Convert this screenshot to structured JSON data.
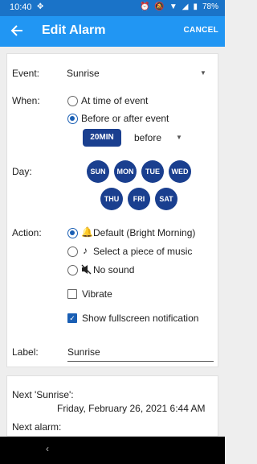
{
  "status_bar": {
    "time": "10:40",
    "battery": "78%",
    "icons": [
      "android-debug-icon",
      "alarm-icon",
      "mute-icon",
      "wifi-icon",
      "signal-icon",
      "battery-icon"
    ]
  },
  "app_bar": {
    "title": "Edit Alarm",
    "cancel_label": "CANCEL",
    "back_icon": "arrow-left-icon",
    "background_color": "#2196f3"
  },
  "form": {
    "event": {
      "label": "Event:",
      "value": "Sunrise"
    },
    "when": {
      "label": "When:",
      "options": [
        {
          "label": "At time of event",
          "selected": false
        },
        {
          "label": "Before or after event",
          "selected": true
        }
      ],
      "offset_value": "20MIN",
      "direction_value": "before"
    },
    "day": {
      "label": "Day:",
      "days": [
        "SUN",
        "MON",
        "TUE",
        "WED",
        "THU",
        "FRI",
        "SAT"
      ]
    },
    "action": {
      "label": "Action:",
      "options": [
        {
          "label": "Default (Bright Morning)",
          "icon": "bell-icon",
          "selected": true
        },
        {
          "label": "Select a piece of music",
          "icon": "music-note-icon",
          "selected": false
        },
        {
          "label": "No sound",
          "icon": "volume-off-icon",
          "selected": false
        }
      ]
    },
    "vibrate": {
      "label": "Vibrate",
      "checked": false
    },
    "fullscreen": {
      "label": "Show fullscreen notification",
      "checked": true
    },
    "alarm_label": {
      "label": "Label:",
      "value": "Sunrise"
    }
  },
  "next_info": {
    "next_event_label": "Next 'Sunrise':",
    "next_event_value": "Friday, February 26, 2021 6:44 AM",
    "next_alarm_label": "Next alarm:"
  },
  "accent_color": "#1a3f8f"
}
